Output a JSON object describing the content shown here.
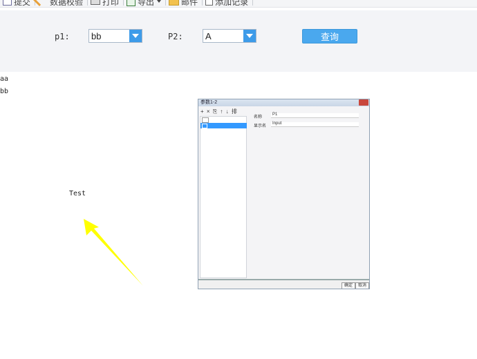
{
  "toolbar": {
    "items": [
      {
        "label": "提交",
        "icon": "submit-icon"
      },
      {
        "label": "数据校验",
        "icon": "verify-icon"
      },
      {
        "label": "打印",
        "icon": "print-icon"
      },
      {
        "label": "导出",
        "icon": "export-icon"
      },
      {
        "label": "邮件",
        "icon": "mail-icon"
      },
      {
        "label": "添加记录",
        "icon": "add-record-icon"
      }
    ]
  },
  "query": {
    "p1_label": "p1:",
    "p1_value": "bb",
    "p2_label": "P2:",
    "p2_value": "A",
    "button_label": "查询"
  },
  "results": [
    "aa",
    "bb"
  ],
  "embedded_window": {
    "title": "参数1-2",
    "toolbar": "+ × ⎘ ↑ ↓ 排",
    "field1_label": "名称",
    "field1_value": "P1",
    "field2_label": "显示名",
    "field2_value": "Input",
    "btn_ok": "确定",
    "btn_cancel": "取消"
  },
  "annotation_text": "Test",
  "colors": {
    "accent": "#4aa8ee",
    "arrow": "#ffff00"
  }
}
